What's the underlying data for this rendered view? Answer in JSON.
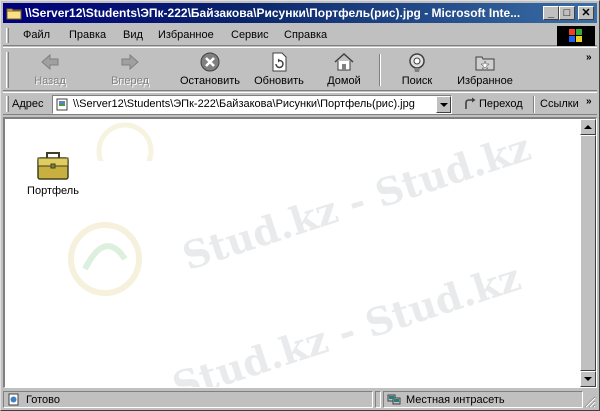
{
  "window": {
    "title": "\\\\Server12\\Students\\ЭПк-222\\Байзакова\\Рисунки\\Портфель(рис).jpg - Microsoft Inte...",
    "minimize_glyph": "_",
    "maximize_glyph": "□",
    "close_glyph": "✕"
  },
  "menu": {
    "items": [
      {
        "label": "Файл",
        "icon": ""
      },
      {
        "label": "Правка"
      },
      {
        "label": "Вид"
      },
      {
        "label": "Избранное"
      },
      {
        "label": "Сервис"
      },
      {
        "label": "Справка"
      }
    ]
  },
  "toolbar": {
    "back": "Назад",
    "forward": "Вперед",
    "stop": "Остановить",
    "refresh": "Обновить",
    "home": "Домой",
    "search": "Поиск",
    "favorites": "Избранное",
    "more": "»"
  },
  "address": {
    "label": "Адрес",
    "value": "\\\\Server12\\Students\\ЭПк-222\\Байзакова\\Рисунки\\Портфель(рис).jpg",
    "go": "Переход",
    "links": "Ссылки",
    "links_more": "»"
  },
  "content": {
    "file_label": "Портфель",
    "watermark_text": "Stud.kz - Stud.kz"
  },
  "status": {
    "text": "Готово",
    "zone": "Местная интрасеть"
  },
  "colors": {
    "titlebar_start": "#00007b",
    "titlebar_end": "#3a6ea5",
    "chrome": "#c0c0c0"
  }
}
